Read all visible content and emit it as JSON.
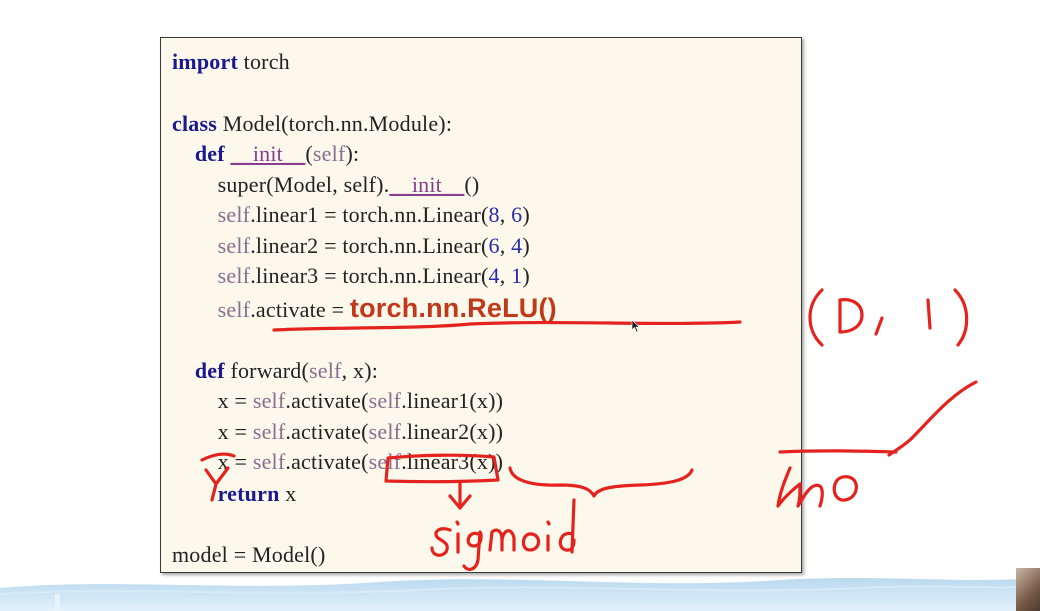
{
  "code": {
    "lines": [
      [
        {
          "t": "import",
          "c": "kw"
        },
        {
          "t": " torch"
        }
      ],
      [],
      [
        {
          "t": "class",
          "c": "kw"
        },
        {
          "t": " Model(torch.nn.Module):"
        }
      ],
      [
        {
          "t": "    "
        },
        {
          "t": "def",
          "c": "kw"
        },
        {
          "t": " "
        },
        {
          "t": "__init__",
          "c": "dunder"
        },
        {
          "t": "("
        },
        {
          "t": "self",
          "c": "slf"
        },
        {
          "t": "):"
        }
      ],
      [
        {
          "t": "        super(Model, self)."
        },
        {
          "t": "__init__",
          "c": "dunder"
        },
        {
          "t": "()"
        }
      ],
      [
        {
          "t": "        "
        },
        {
          "t": "self",
          "c": "slf"
        },
        {
          "t": ".linear1 = torch.nn.Linear("
        },
        {
          "t": "8",
          "c": "num"
        },
        {
          "t": ", "
        },
        {
          "t": "6",
          "c": "num"
        },
        {
          "t": ")"
        }
      ],
      [
        {
          "t": "        "
        },
        {
          "t": "self",
          "c": "slf"
        },
        {
          "t": ".linear2 = torch.nn.Linear("
        },
        {
          "t": "6",
          "c": "num"
        },
        {
          "t": ", "
        },
        {
          "t": "4",
          "c": "num"
        },
        {
          "t": ")"
        }
      ],
      [
        {
          "t": "        "
        },
        {
          "t": "self",
          "c": "slf"
        },
        {
          "t": ".linear3 = torch.nn.Linear("
        },
        {
          "t": "4",
          "c": "num"
        },
        {
          "t": ", "
        },
        {
          "t": "1",
          "c": "num"
        },
        {
          "t": ")"
        }
      ],
      [
        {
          "t": "        "
        },
        {
          "t": "self",
          "c": "slf"
        },
        {
          "t": ".activate = "
        },
        {
          "t": "torch.nn.ReLU()",
          "c": "relu"
        }
      ],
      [],
      [
        {
          "t": "    "
        },
        {
          "t": "def",
          "c": "kw"
        },
        {
          "t": " forward("
        },
        {
          "t": "self",
          "c": "slf"
        },
        {
          "t": ", x):"
        }
      ],
      [
        {
          "t": "        x = "
        },
        {
          "t": "self",
          "c": "slf"
        },
        {
          "t": ".activate("
        },
        {
          "t": "self",
          "c": "slf"
        },
        {
          "t": ".linear1(x))"
        }
      ],
      [
        {
          "t": "        x = "
        },
        {
          "t": "self",
          "c": "slf"
        },
        {
          "t": ".activate("
        },
        {
          "t": "self",
          "c": "slf"
        },
        {
          "t": ".linear2(x))"
        }
      ],
      [
        {
          "t": "        x = "
        },
        {
          "t": "self",
          "c": "slf"
        },
        {
          "t": ".activate("
        },
        {
          "t": "self",
          "c": "slf"
        },
        {
          "t": ".linear3(x))"
        }
      ],
      [
        {
          "t": "        "
        },
        {
          "t": "return",
          "c": "kw"
        },
        {
          "t": " x"
        }
      ],
      [],
      [
        {
          "t": "model = Model()"
        }
      ]
    ]
  },
  "annotations": {
    "ink_color": "#e4231f",
    "handwritten_texts": [
      "(0, 1)",
      "sigmoid",
      "ŷ",
      "ln 0"
    ]
  },
  "colors": {
    "code_background": "#fdf8ec",
    "keyword": "#1a1a8c",
    "self": "#8a6d8f",
    "number": "#2a2aa8",
    "relu_highlight": "#c0391a"
  }
}
